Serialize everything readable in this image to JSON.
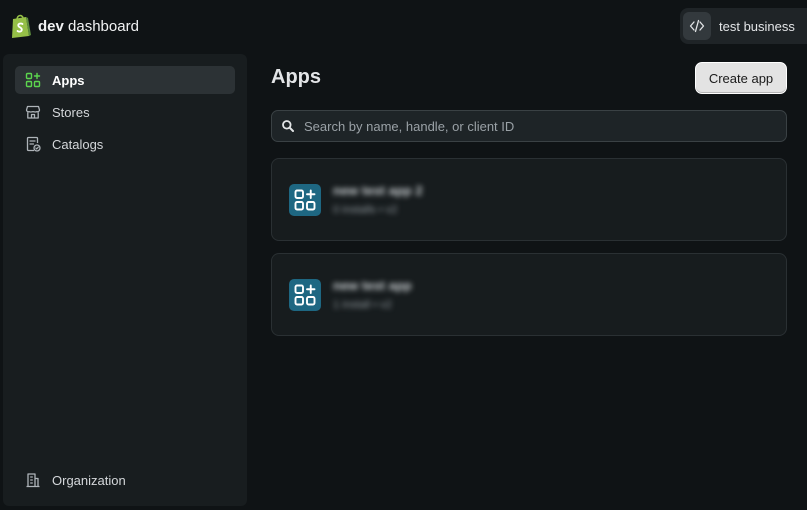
{
  "brand": {
    "bold": "dev",
    "rest": " dashboard",
    "color": "#95bf47"
  },
  "account": {
    "name": "test business",
    "icon": "code-icon"
  },
  "sidebar": {
    "items": [
      {
        "label": "Apps",
        "icon": "apps-icon",
        "active": true
      },
      {
        "label": "Stores",
        "icon": "store-icon",
        "active": false
      },
      {
        "label": "Catalogs",
        "icon": "catalog-icon",
        "active": false
      }
    ],
    "footer": {
      "label": "Organization",
      "icon": "organization-icon"
    }
  },
  "main": {
    "title": "Apps",
    "create_label": "Create app",
    "search": {
      "placeholder": "Search by name, handle, or client ID",
      "value": ""
    },
    "apps": [
      {
        "name": "new test app 2",
        "meta": "0 installs • v2",
        "icon": "app-icon"
      },
      {
        "name": "new test app",
        "meta": "1 install • v2",
        "icon": "app-icon"
      }
    ]
  },
  "colors": {
    "background": "#0f1315",
    "sidebar": "#181d1f",
    "active_item": "#2c3235",
    "app_icon_bg": "#1e6782",
    "accent_green": "#5cd64e"
  }
}
